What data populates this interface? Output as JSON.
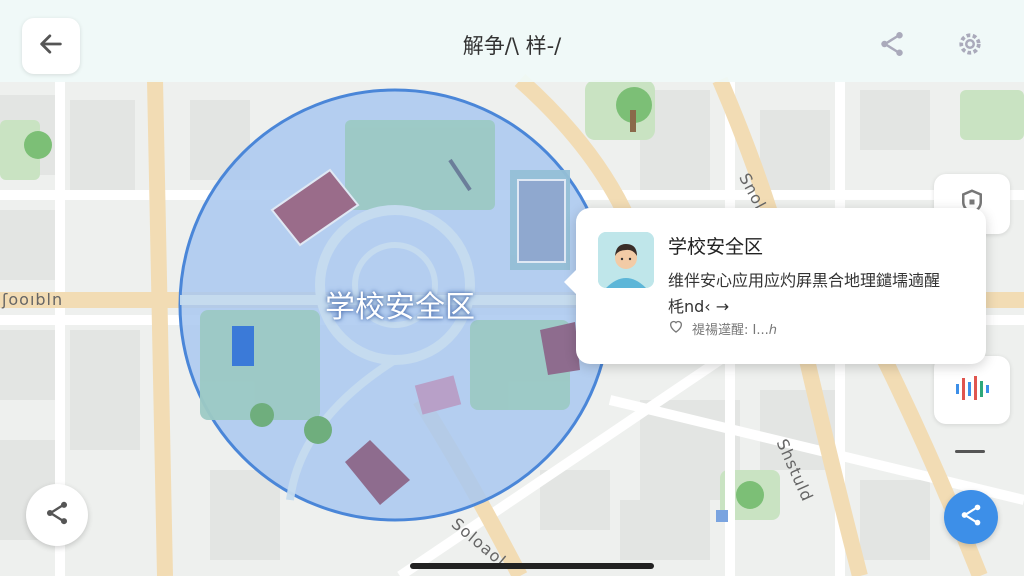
{
  "header": {
    "title": "解争/\\ 样-/"
  },
  "zone": {
    "name": "学校安全区"
  },
  "road_labels": [
    "Snoldb",
    "ʃooıbln",
    "Shstuld",
    "Soloaol"
  ],
  "popup": {
    "title": "学校安全区",
    "description": "维伴安心应用应灼屛黒合地理鑓壖遖醒",
    "link": "枆nd‹ →",
    "footer": "禔禓遳醒: Ι...ℎ"
  },
  "icons": {
    "back": "back-arrow-icon",
    "share_top": "share-icon",
    "settings": "gear-icon",
    "shield": "shield-icon",
    "audio": "sound-wave-icon",
    "share_bottom": "share-icon",
    "heart": "heart-icon"
  },
  "colors": {
    "zone_fill": "#a9c8f0",
    "zone_stroke": "#4a86d8",
    "share_fab": "#3d8fe8",
    "popup_bg": "#ffffff"
  }
}
